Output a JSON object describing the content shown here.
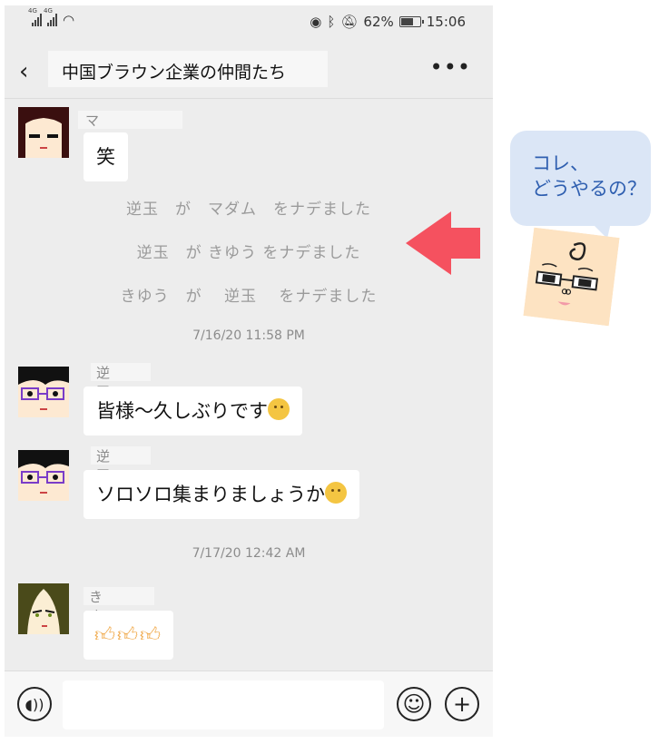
{
  "status": {
    "time": "15:06",
    "battery": "62%",
    "net1": "4G",
    "net2": "4G"
  },
  "header": {
    "title": "中国ブラウン企業の仲間たち",
    "back_icon": "chevron-left-icon",
    "more_icon": "more-dots-icon"
  },
  "messages": [
    {
      "name": "マダム",
      "text": "笑"
    },
    {
      "name": "逆玉",
      "text": "皆様〜久しぶりです",
      "emoji": "hugging-face-emoji"
    },
    {
      "name": "逆玉",
      "text": "ソロソロ集まりましょうか",
      "emoji": "thinking-face-emoji"
    },
    {
      "name": "きゆう",
      "text": "",
      "emoji": "thumbs-up-emoji"
    }
  ],
  "system_messages": [
    "逆玉　が　マダム　をナデました",
    "逆玉　が きゆう をナデました",
    "きゆう　が　 逆玉　 をナデました"
  ],
  "timestamps": [
    "7/16/20 11:58 PM",
    "7/17/20 12:42 AM"
  ],
  "annotation": {
    "text": "コレ、\nどうやるの？",
    "arrow_color": "#f5515f",
    "bubble_color": "#dbe6f6"
  },
  "bottom_bar": {
    "voice_icon": "voice-icon",
    "emoji_icon": "smiley-icon",
    "plus_icon": "plus-icon"
  }
}
